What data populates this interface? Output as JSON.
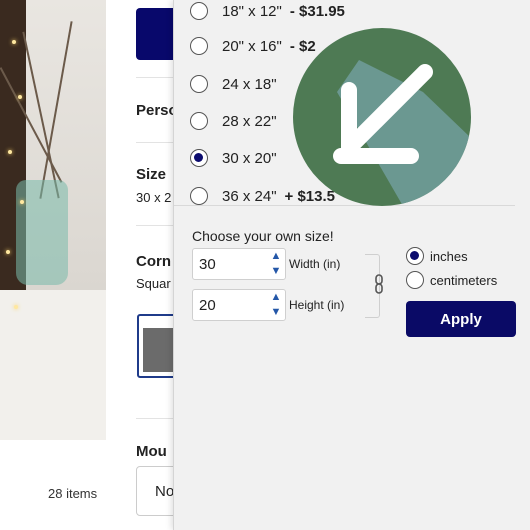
{
  "page": {
    "section_personalize": "Perso",
    "section_size": "Size",
    "size_value": "30 x 2",
    "section_corner": "Corn",
    "corner_value": "Squar",
    "section_mount": "Mou",
    "mount_value": "No",
    "item_count": "28 items"
  },
  "size_options": [
    {
      "label": "18\" x 12\"",
      "price": "- $31.95",
      "selected": false
    },
    {
      "label": "20\" x 16\"",
      "price": "- $2",
      "selected": false
    },
    {
      "label": "24 x 18\"",
      "price": "",
      "selected": false
    },
    {
      "label": "28 x 22\"",
      "price": "",
      "selected": false
    },
    {
      "label": "30 x 20\"",
      "price": "",
      "selected": true
    },
    {
      "label": "36 x 24\"",
      "price": "+ $13.5",
      "selected": false
    }
  ],
  "custom_size": {
    "heading": "Choose your own size!",
    "width_value": "30",
    "width_label": "Width (in)",
    "height_value": "20",
    "height_label": "Height (in)",
    "unit_inches": "inches",
    "unit_centimeters": "centimeters",
    "unit_selected": "inches",
    "apply_label": "Apply"
  },
  "colors": {
    "primary": "#0a0a66",
    "badge": "#4e7a54",
    "badge_shadow": "#6f9b98"
  }
}
